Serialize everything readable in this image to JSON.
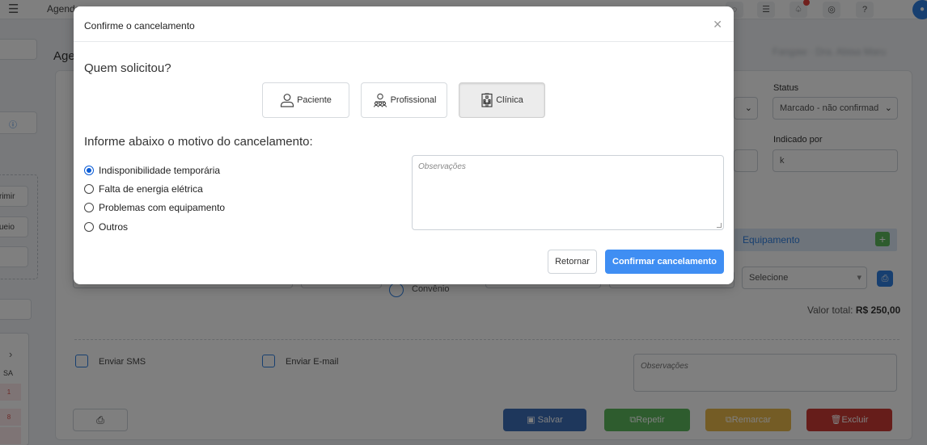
{
  "topbar": {
    "menu_text": "Agenda",
    "icons": [
      "chat-icon",
      "list-icon",
      "bell-icon",
      "message-icon",
      "help-icon",
      "user-icon"
    ]
  },
  "background": {
    "page_title": "Age",
    "blurred_name": "Fangaw · Dra. Abiaa Maru",
    "left_buttons": [
      "rimir",
      "ueio"
    ],
    "calendar_header": "SA",
    "calendar_days": [
      "1",
      "8"
    ],
    "status_label": "Status",
    "status_value": "Marcado - não confirmad",
    "indicado_label": "Indicado por",
    "indicado_value": "k",
    "equipamento_label": "Equipamento",
    "selecione_value": "Selecione",
    "convenio_label": "Convênio",
    "valor_label": "Valor total:",
    "valor_value": "R$ 250,00",
    "sms_label": "Enviar SMS",
    "email_label": "Enviar E-mail",
    "obs_placeholder": "Observações",
    "buttons": {
      "salvar": "Salvar",
      "repetir": "Repetir",
      "remarcar": "Remarcar",
      "excluir": "Excluir"
    },
    "colors": {
      "salvar": "#3c6fb9",
      "repetir": "#5cb85c",
      "remarcar": "#e8b84a",
      "excluir": "#cc3b35"
    }
  },
  "modal": {
    "title": "Confirme o cancelamento",
    "question": "Quem solicitou?",
    "options": [
      {
        "label": "Paciente",
        "icon": "user-icon",
        "active": false
      },
      {
        "label": "Profissional",
        "icon": "group-icon",
        "active": false
      },
      {
        "label": "Clínica",
        "icon": "building-icon",
        "active": true
      }
    ],
    "motivo_title": "Informe abaixo o motivo do cancelamento:",
    "motivos": [
      {
        "label": "Indisponibilidade temporária",
        "checked": true
      },
      {
        "label": "Falta de energia elétrica",
        "checked": false
      },
      {
        "label": "Problemas com equipamento",
        "checked": false
      },
      {
        "label": "Outros",
        "checked": false
      }
    ],
    "obs_placeholder": "Observações",
    "btn_retornar": "Retornar",
    "btn_confirmar": "Confirmar cancelamento",
    "accent_color": "#3f8ef3"
  }
}
